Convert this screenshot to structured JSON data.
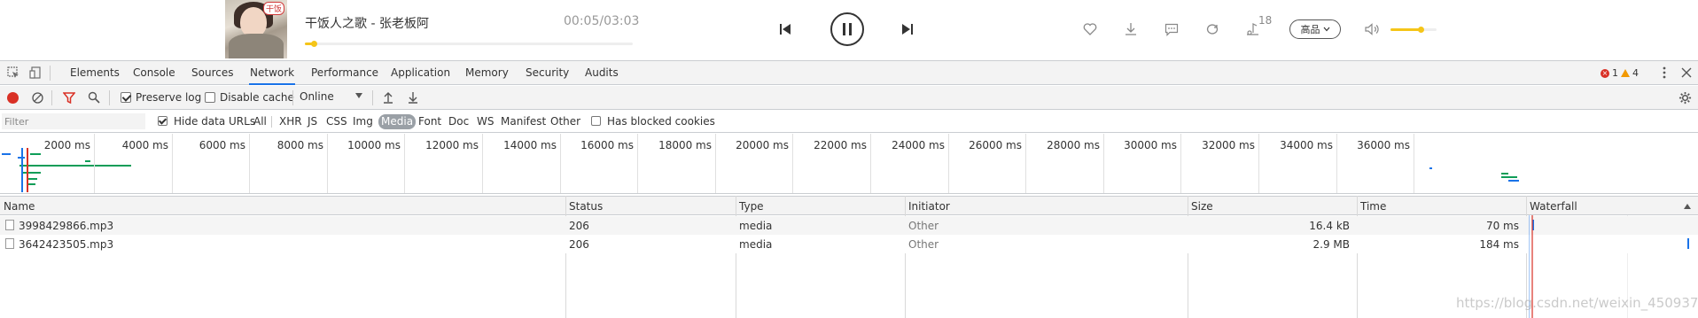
{
  "player": {
    "album_tag": "干饭",
    "song_title": "干饭人之歌 - 张老板阿",
    "time": "00:05/03:03",
    "progress": 0.027,
    "playlist_count": "18",
    "quality": "高品",
    "volume": 0.65,
    "accent_color": "#f5c518"
  },
  "devtools": {
    "tabs": [
      "Elements",
      "Console",
      "Sources",
      "Network",
      "Performance",
      "Application",
      "Memory",
      "Security",
      "Audits"
    ],
    "active_tab": "Network",
    "error_count": "1",
    "warning_count": "4",
    "toolbar": {
      "preserve_log": "Preserve log",
      "preserve_log_checked": true,
      "disable_cache": "Disable cache",
      "disable_cache_checked": false,
      "throttling": "Online"
    },
    "filter": {
      "placeholder": "Filter",
      "hide_data_urls": "Hide data URLs",
      "types": [
        "All",
        "XHR",
        "JS",
        "CSS",
        "Img",
        "Media",
        "Font",
        "Doc",
        "WS",
        "Manifest",
        "Other"
      ],
      "active_type": "Media",
      "has_blocked_cookies": "Has blocked cookies"
    },
    "overview": {
      "ticks": [
        "2000 ms",
        "4000 ms",
        "6000 ms",
        "8000 ms",
        "10000 ms",
        "12000 ms",
        "14000 ms",
        "16000 ms",
        "18000 ms",
        "20000 ms",
        "22000 ms",
        "24000 ms",
        "26000 ms",
        "28000 ms",
        "30000 ms",
        "32000 ms",
        "34000 ms",
        "36000 ms"
      ]
    },
    "table": {
      "columns": [
        "Name",
        "Status",
        "Type",
        "Initiator",
        "Size",
        "Time",
        "Waterfall"
      ],
      "rows": [
        {
          "name": "3998429866.mp3",
          "status": "206",
          "type": "media",
          "initiator": "Other",
          "size": "16.4 kB",
          "time": "70 ms"
        },
        {
          "name": "3642423505.mp3",
          "status": "206",
          "type": "media",
          "initiator": "Other",
          "size": "2.9 MB",
          "time": "184 ms"
        }
      ]
    }
  },
  "watermark": "https://blog.csdn.net/weixin_45093700"
}
